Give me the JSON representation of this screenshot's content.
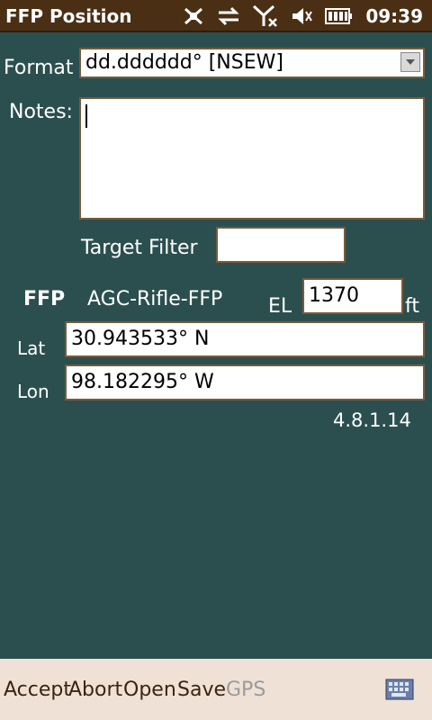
{
  "title_bar": {
    "app_title": "FFP Position",
    "time": "09:39",
    "status_icons": [
      "sync-icon",
      "data-transfer-icon",
      "no-signal-icon",
      "muted-speaker-icon",
      "battery-icon"
    ]
  },
  "form": {
    "format_label": "Format",
    "format_value": "dd.dddddd° [NSEW]",
    "notes_label": "Notes:",
    "notes_value": "",
    "target_filter_label": "Target Filter",
    "target_filter_value": "",
    "ffp_label": "FFP",
    "ffp_name": "AGC-Rifle-FFP",
    "el_label": "EL",
    "el_value": "1370",
    "el_unit": "ft",
    "lat_label": "Lat",
    "lat_value": "30.943533° N",
    "lon_label": "Lon",
    "lon_value": "98.182295° W",
    "version": "4.8.1.14"
  },
  "menu": {
    "accept": "Accept",
    "abort": "Abort",
    "open": "Open",
    "save": "Save",
    "gps": "GPS"
  },
  "colors": {
    "background": "#2b4f4f",
    "title_bar": "#4a2f14",
    "menu_bar": "#efe1d6",
    "field_border": "#7a5a3a"
  }
}
